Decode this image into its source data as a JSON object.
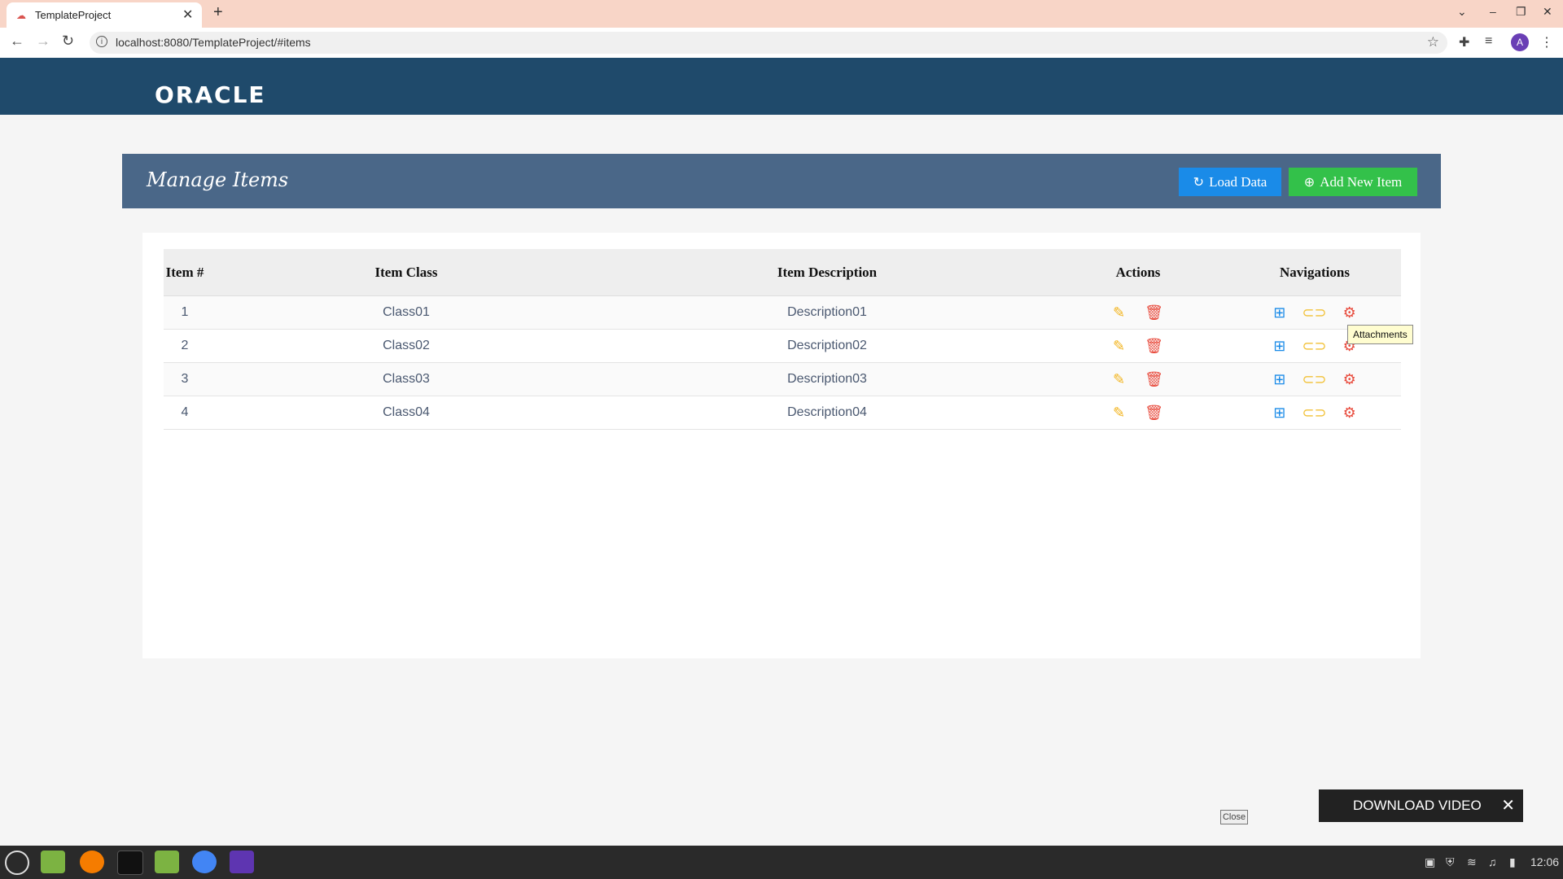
{
  "browser": {
    "tab_title": "TemplateProject",
    "url": "localhost:8080/TemplateProject/#items"
  },
  "header": {
    "logo": "ORACLE"
  },
  "panel": {
    "title": "Manage Items",
    "load_label": "Load Data",
    "add_label": "Add New Item"
  },
  "table": {
    "headers": [
      "Item #",
      "Item Class",
      "Item Description",
      "Actions",
      "Navigations"
    ],
    "rows": [
      {
        "num": "1",
        "cls": "Class01",
        "desc": "Description01"
      },
      {
        "num": "2",
        "cls": "Class02",
        "desc": "Description02"
      },
      {
        "num": "3",
        "cls": "Class03",
        "desc": "Description03"
      },
      {
        "num": "4",
        "cls": "Class04",
        "desc": "Description04"
      }
    ]
  },
  "tooltip": "Attachments",
  "close_label": "Close",
  "download_video": "DOWNLOAD VIDEO",
  "taskbar": {
    "time": "12:06"
  },
  "icons": {
    "edit": "pencil-icon",
    "delete": "trash-icon",
    "tree": "tree-icon",
    "attach": "paperclip-icon",
    "settings": "gear-icon"
  },
  "colors": {
    "header": "#1f4a6b",
    "panel": "#4a6788",
    "load": "#1a8be8",
    "add": "#33c14a"
  }
}
